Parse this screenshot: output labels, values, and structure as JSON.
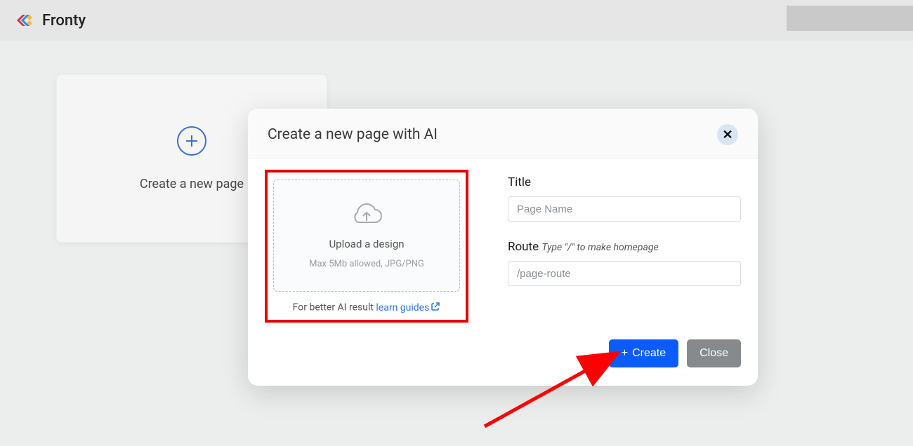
{
  "header": {
    "app_name": "Fronty"
  },
  "card": {
    "label": "Create a new page"
  },
  "modal": {
    "title": "Create a new page with AI",
    "upload": {
      "label": "Upload a design",
      "hint": "Max 5Mb allowed, JPG/PNG",
      "guide_prefix": "For better AI result ",
      "guide_link": "learn guides"
    },
    "fields": {
      "title_label": "Title",
      "title_placeholder": "Page Name",
      "route_label": "Route",
      "route_hint": "Type \"/\" to make homepage",
      "route_placeholder": "/page-route"
    },
    "buttons": {
      "create": "Create",
      "close": "Close"
    }
  }
}
